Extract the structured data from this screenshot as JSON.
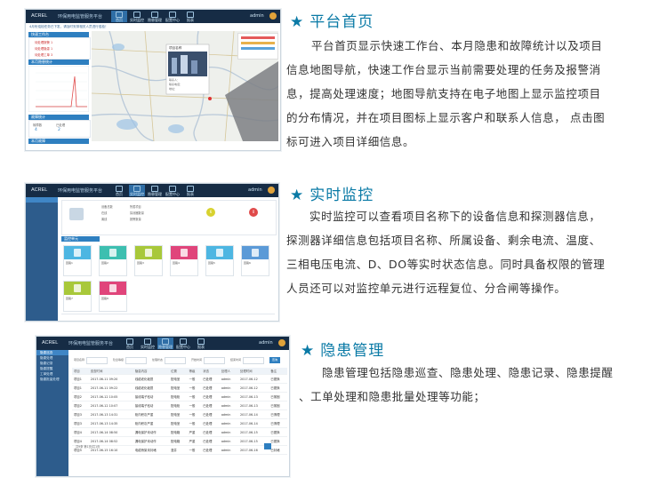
{
  "sections": [
    {
      "title": "平台首页",
      "lines": [
        "平台首页显示快速工作台、本月隐患和故障统计以及项目",
        "信息地图导航，快速工作台显示当前需要处理的任务及报警消",
        "息，提高处理速度；地图导航支持在电子地图上显示监控项目",
        "的分布情况，并在项目图标上显示客户和联系人信息， 点击图",
        "标可进入项目详细信息。"
      ]
    },
    {
      "title": "实时监控",
      "lines": [
        "实时监控可以查看项目名称下的设备信息和探测器信息，",
        "探测器详细信息包括项目名称、所属设备、剩余电流、温度、",
        "三相电压电流、D、DO等实时状态信息。同时具备权限的管理",
        "人员还可以对监控单元进行远程复位、分合闸等操作。"
      ]
    },
    {
      "title": "隐患管理",
      "lines": [
        "隐患管理包括隐患巡查、隐患处理、隐患记录、隐患提醒",
        "、工单处理和隐患批量处理等功能；"
      ]
    }
  ],
  "app": {
    "logo": "ACREL",
    "system_name": "环保用电监管服务平台",
    "nav": [
      "首页",
      "实时监控",
      "隐患管理",
      "配置中心",
      "报表"
    ],
    "user": "admin",
    "colors": {
      "header": "#162c45",
      "accent": "#2e7fc0",
      "sidebar": "#2d5c8c"
    }
  },
  "shot1": {
    "notice": "4月份巡检任务已下发，请及时安排相关人员进行巡检！",
    "panel_todo": "快速工作台",
    "panel_chart": "本月隐患统计",
    "panel_fault": "故障统计",
    "panel_bottom": "本月故障",
    "todo_items": [
      "待处理报警 1",
      "待处理隐患 1",
      "待处理工单 3"
    ],
    "fault_labels": [
      "故障数",
      "已处理"
    ],
    "fault_values": [
      "4",
      "2"
    ],
    "map_popup_title": "项目名称",
    "map_popup_lines": [
      "联系人：",
      "联系电话：",
      "地址："
    ]
  },
  "shot2": {
    "summary_left": [
      "设备总数",
      "在线",
      "离线"
    ],
    "summary_mid": [
      "所属项目",
      "探测器数量",
      "报警数量"
    ],
    "badge1_value": "6",
    "badge2_value": "0",
    "group_label": "监控单元",
    "card_labels": [
      "回路1",
      "回路2",
      "回路3",
      "回路4",
      "回路5",
      "回路6",
      "回路7",
      "回路8"
    ],
    "card_colors": [
      "#4db6e2",
      "#3dbfb0",
      "#a8c83a",
      "#e0457b",
      "#4db6e2",
      "#5b9ad7",
      "#a8c83a",
      "#e0457b"
    ]
  },
  "shot3": {
    "side_items": [
      "隐患巡查",
      "隐患处理",
      "隐患记录",
      "隐患提醒",
      "工单处理",
      "隐患批量处理"
    ],
    "filters": [
      "项目名称",
      "隐患等级",
      "处理状态",
      "开始时间",
      "结束时间"
    ],
    "search_btn": "查询",
    "columns": [
      "项目",
      "巡查时间",
      "隐患内容",
      "位置",
      "等级",
      "状态",
      "处理人",
      "处理时间",
      "备注"
    ],
    "rows": [
      [
        "项目1",
        "2017-06-11 09:20",
        "线缆老化破损",
        "配电室",
        "一般",
        "已处理",
        "admin",
        "2017-06-12",
        "已更换"
      ],
      [
        "项目1",
        "2017-06-11 09:22",
        "线缆老化破损",
        "配电室",
        "一般",
        "已处理",
        "admin",
        "2017-06-12",
        "已更换"
      ],
      [
        "项目2",
        "2017-06-12 10:05",
        "接线端子松动",
        "配电柜",
        "一般",
        "已处理",
        "admin",
        "2017-06-13",
        "已紧固"
      ],
      [
        "项目2",
        "2017-06-12 10:07",
        "接线端子松动",
        "配电柜",
        "一般",
        "已处理",
        "admin",
        "2017-06-13",
        "已紧固"
      ],
      [
        "项目3",
        "2017-06-13 14:31",
        "柜内积灰严重",
        "配电室",
        "一般",
        "已处理",
        "admin",
        "2017-06-14",
        "已清理"
      ],
      [
        "项目3",
        "2017-06-13 14:35",
        "柜内积灰严重",
        "配电室",
        "一般",
        "已处理",
        "admin",
        "2017-06-14",
        "已清理"
      ],
      [
        "项目4",
        "2017-06-14 08:50",
        "漏电保护未动作",
        "配电箱",
        "严重",
        "已处理",
        "admin",
        "2017-06-15",
        "已更换"
      ],
      [
        "项目4",
        "2017-06-14 08:52",
        "漏电保护未动作",
        "配电箱",
        "严重",
        "已处理",
        "admin",
        "2017-06-15",
        "已更换"
      ],
      [
        "项目5",
        "2017-06-15 16:10",
        "电缆桥架未封堵",
        "竖井",
        "一般",
        "已处理",
        "admin",
        "2017-06-16",
        "已封堵"
      ]
    ],
    "footer": "共9条 第1页/共1页"
  }
}
